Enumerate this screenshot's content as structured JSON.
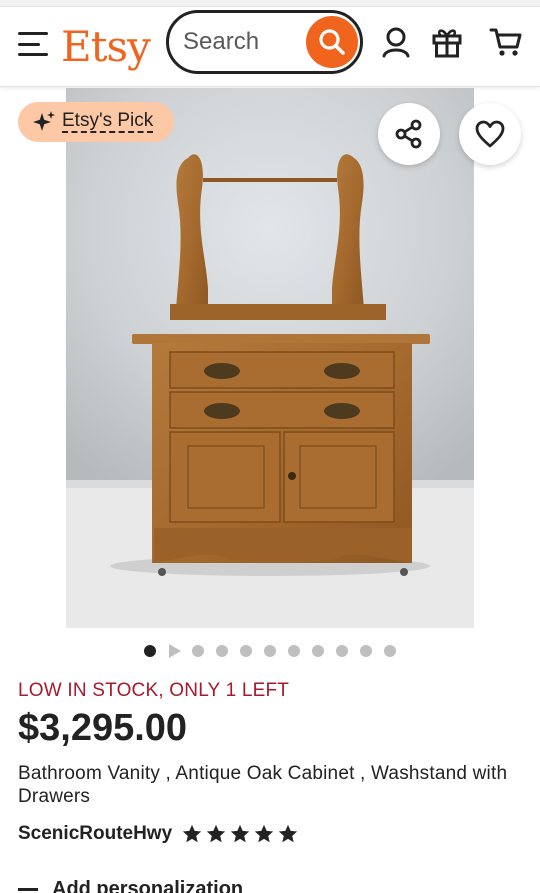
{
  "header": {
    "logo": "Etsy",
    "search_placeholder": "Search",
    "brand_color": "#F1641E"
  },
  "listing": {
    "badge_label": "Etsy's Pick",
    "stock_notice": "LOW IN STOCK, ONLY 1 LEFT",
    "price": "$3,295.00",
    "title": "Bathroom Vanity , Antique Oak Cabinet , Washstand with Drawers",
    "shop_name": "ScenicRouteHwy",
    "rating_stars": 5,
    "add_personalization_label": "Add personalization",
    "image_count": 11,
    "active_image_index": 0
  },
  "colors": {
    "stock_text": "#A61A2E",
    "badge_bg": "#FCC8A6"
  },
  "icons": {
    "menu": "hamburger-icon",
    "search": "search-icon",
    "account": "user-icon",
    "gift": "gift-icon",
    "cart": "cart-icon",
    "pick": "sparkle-icon",
    "share": "share-icon",
    "favorite": "heart-icon",
    "rating": "star-icon"
  }
}
